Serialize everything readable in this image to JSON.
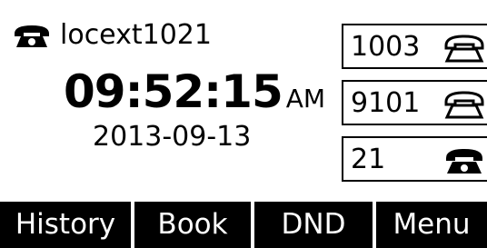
{
  "status": {
    "account": "locext1021",
    "icon": "handset-icon"
  },
  "clock": {
    "time": "09:52:15",
    "ampm": "AM",
    "date": "2013-09-13"
  },
  "lines": [
    {
      "number": "1003",
      "state": "idle",
      "icon": "handset-outline-icon"
    },
    {
      "number": "9101",
      "state": "idle",
      "icon": "handset-outline-icon"
    },
    {
      "number": "21",
      "state": "registered",
      "icon": "handset-filled-icon"
    }
  ],
  "softkeys": [
    "History",
    "Book",
    "DND",
    "Menu"
  ]
}
